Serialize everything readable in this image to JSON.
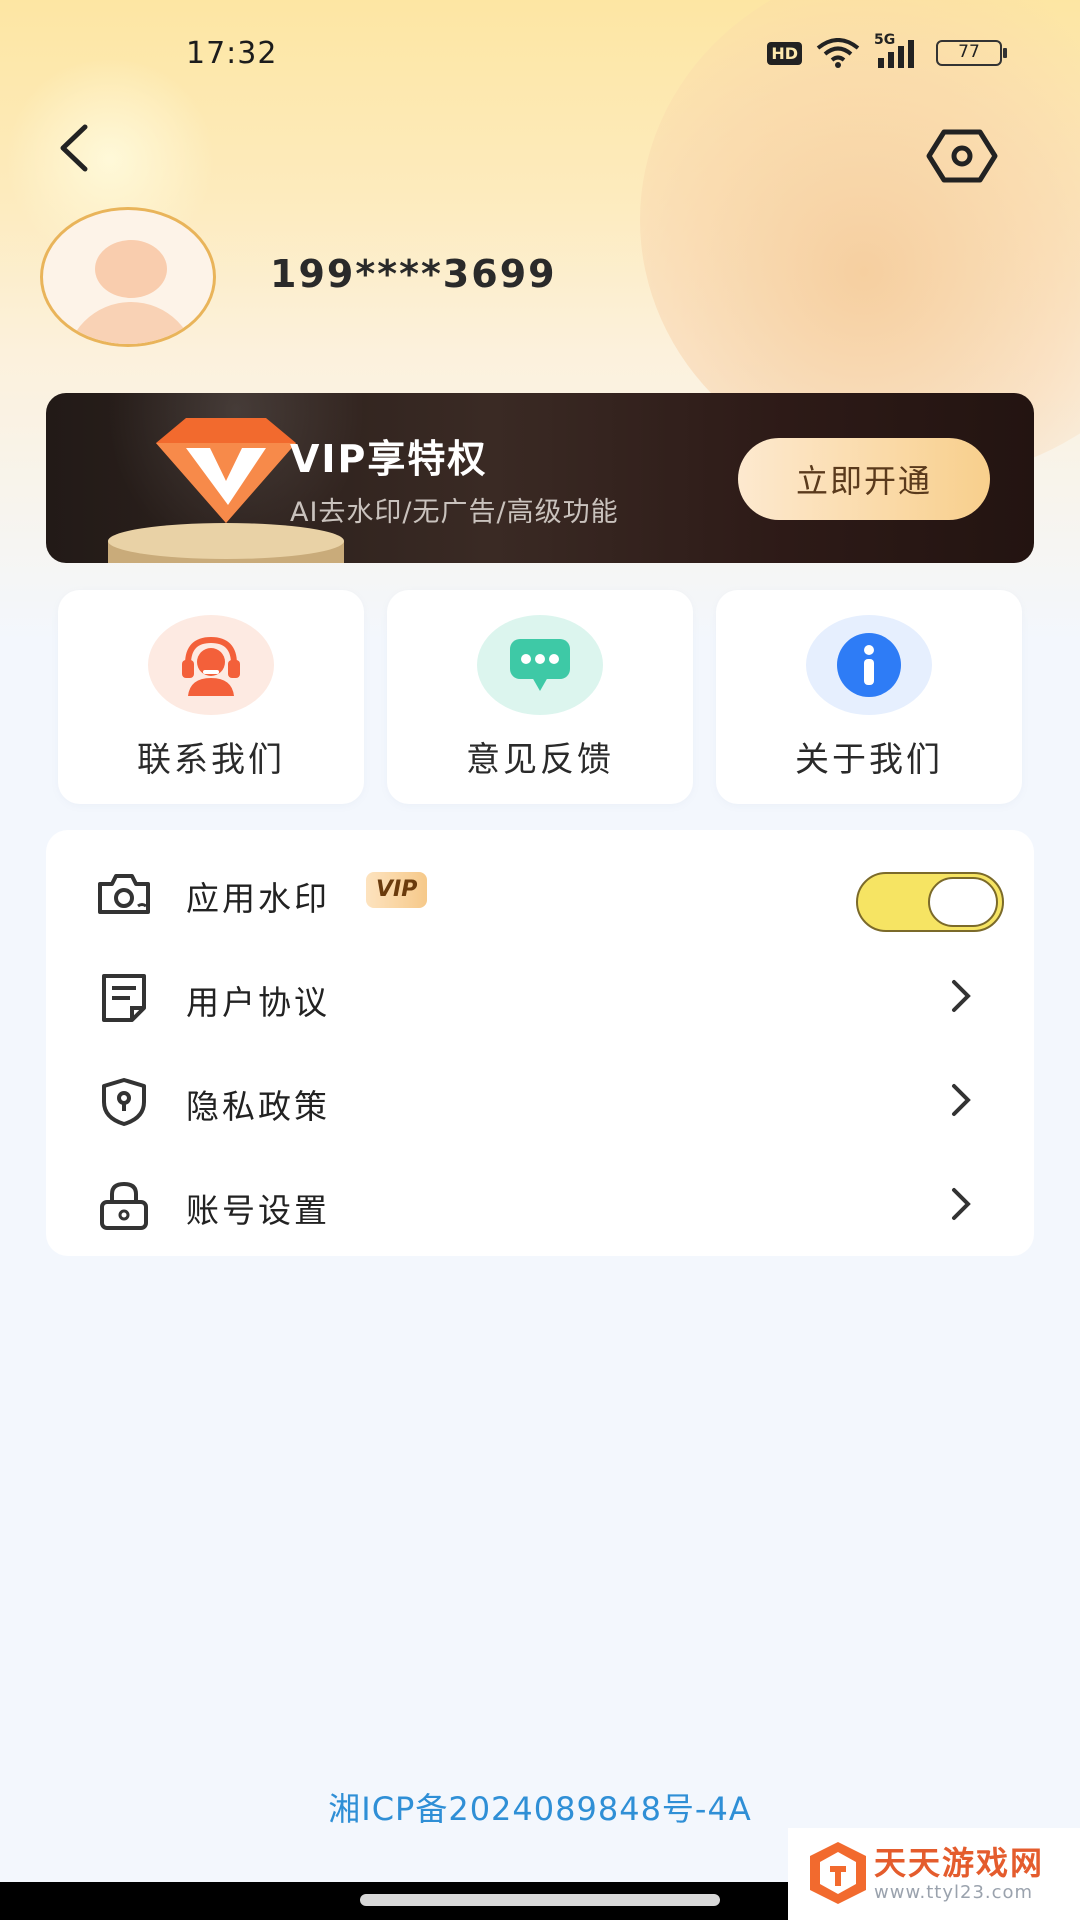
{
  "status_bar": {
    "time": "17:32",
    "hd_label": "HD",
    "network_label": "5G",
    "battery": "77"
  },
  "header": {
    "back_icon": "chevron-left-icon",
    "settings_icon": "hexagon-eye-icon"
  },
  "profile": {
    "username": "199****3699"
  },
  "vip_banner": {
    "title": "VIP享特权",
    "subtitle": "AI去水印/无广告/高级功能",
    "cta_label": "立即开通"
  },
  "quick_actions": [
    {
      "label": "联系我们",
      "icon": "customer-service-icon",
      "color": "#f3603a"
    },
    {
      "label": "意见反馈",
      "icon": "chat-bubble-icon",
      "color": "#3ec9a6"
    },
    {
      "label": "关于我们",
      "icon": "info-icon",
      "color": "#2e7cf6"
    }
  ],
  "settings": {
    "watermark": {
      "label": "应用水印",
      "badge": "VIP",
      "toggle_on": true,
      "icon": "camera-icon"
    },
    "items": [
      {
        "label": "用户协议",
        "icon": "document-icon"
      },
      {
        "label": "隐私政策",
        "icon": "shield-icon"
      },
      {
        "label": "账号设置",
        "icon": "lock-icon"
      }
    ]
  },
  "footer": {
    "icp": "湘ICP备2024089848号-4A"
  },
  "watermark_overlay": {
    "name": "天天游戏网",
    "url": "www.ttyl23.com"
  },
  "colors": {
    "accent_gold": "#f8cf8c",
    "icp_link": "#2f8fd6",
    "toggle_on": "#f6e463"
  }
}
